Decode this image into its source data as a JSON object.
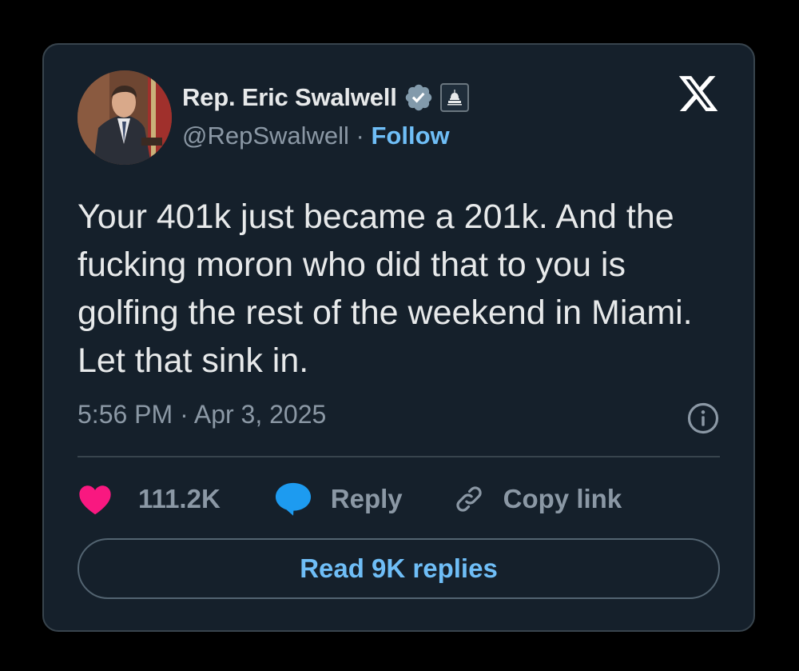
{
  "author": {
    "display_name": "Rep. Eric Swalwell",
    "handle": "@RepSwalwell",
    "separator": " · ",
    "follow_label": "Follow"
  },
  "icons": {
    "verified": "verified-badge-icon",
    "government": "government-capitol-icon",
    "platform": "x-logo-icon",
    "info": "info-icon",
    "like": "heart-icon",
    "reply": "speech-bubble-icon",
    "copy": "link-icon"
  },
  "tweet": {
    "text": "Your 401k just became a 201k. And the fucking moron who did that to you is golfing the rest of the weekend in Miami. Let that sink in.",
    "timestamp": "5:56 PM · Apr 3, 2025"
  },
  "actions": {
    "like_count": "111.2K",
    "reply_label": "Reply",
    "copy_label": "Copy link"
  },
  "read_replies_label": "Read 9K replies",
  "colors": {
    "card_background": "#15202b",
    "accent_blue": "#6fbef7",
    "like_pink": "#f91880",
    "reply_blue": "#1d9bf0",
    "muted_text": "#8b98a5",
    "primary_text": "#e7e9ea"
  }
}
